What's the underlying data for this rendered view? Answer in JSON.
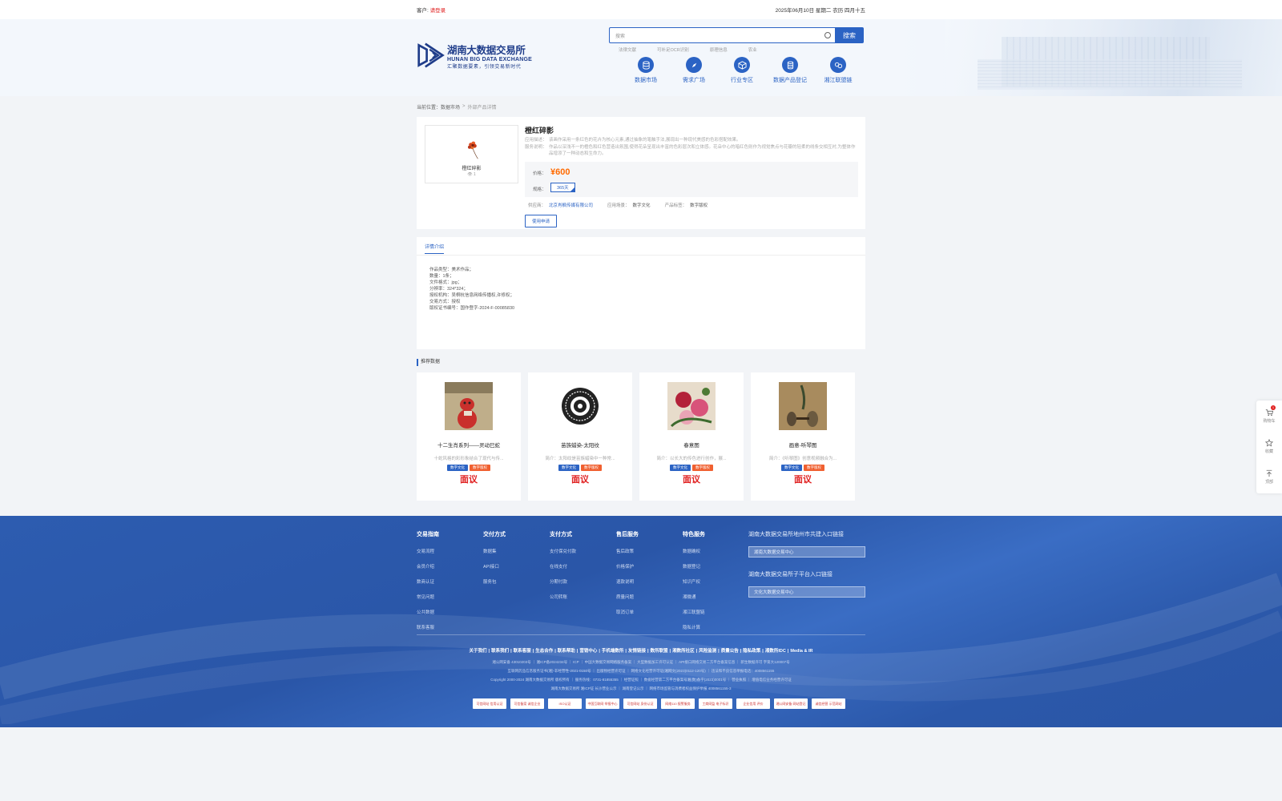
{
  "topbar": {
    "greeting": "客户:",
    "login": "请登录",
    "date": "2025年06月10日 星期二 农历 四月十五"
  },
  "logo": {
    "cn": "湖南大数据交易所",
    "en": "HUNAN BIG DATA EXCHANGE",
    "slogan": "汇聚数据要素，引领交易新时代"
  },
  "search": {
    "placeholder": "搜索",
    "button": "搜索",
    "hotwords": [
      "法律文献",
      "可补足OCR识别",
      "原理信息",
      "农业"
    ]
  },
  "nav": [
    {
      "label": "数据市场",
      "icon": "database-icon"
    },
    {
      "label": "需求广场",
      "icon": "compass-icon"
    },
    {
      "label": "行业专区",
      "icon": "cube-icon"
    },
    {
      "label": "数据产品登记",
      "icon": "register-icon"
    },
    {
      "label": "湘江联盟链",
      "icon": "chain-icon"
    }
  ],
  "breadcrumb": {
    "prefix": "当前位置：",
    "level1": "数据市场",
    "sep": ">",
    "current": "外部产品详情"
  },
  "product": {
    "title": "橙红碎影",
    "image_name": "橙红碎影",
    "views": "👁 1",
    "desc_label": "应用描述：",
    "desc": "该画作采用一条红色的花卉为核心元素,通过抽象的笔触手法,展现出一种现代美感的色彩搭配效果。",
    "service_label": "服务说明：",
    "service": "作品以深浅不一的橙色和红色营造出氛围,使得花朵呈现出丰富的色彩层次和立体感。花朵中心的暗红色则作为视觉焦点与花瓣的轻柔的线条交相互衬,为整体作品增添了一种动态和生命力。",
    "price_label": "价格：",
    "price": "¥600",
    "spec_label": "规格：",
    "spec": "365天",
    "supplier_label": "供应商：",
    "supplier": "北京肖枫传媒有限公司",
    "scene_label": "应用场景：",
    "scene": "数字文化",
    "tag_label": "产品标签：",
    "tag": "数字版权",
    "apply_button": "使用申请"
  },
  "detail": {
    "tab": "详情介绍",
    "lines": [
      "作品类型：美术作品；",
      "数量：1条；",
      "文件格式：jpg；",
      "分辨率：324*324；",
      "授权机构：吴桐杭信息网络传播权,许修权；",
      "交易方式：授权",
      "版权证书编号：国作登字-2024-F-00085830"
    ]
  },
  "recommend": {
    "title": "推荐数据",
    "items": [
      {
        "name": "十二生肖系列——灵动巳蛇",
        "desc": "十蛇风格的彩形象结合了现代与传...",
        "tag1": "数字文化",
        "tag2": "数字版权",
        "price": "面议"
      },
      {
        "name": "苗族蜡染-太阳纹",
        "desc": "简介：太阳纹是苗族蜡染中一种常...",
        "tag1": "数字文化",
        "tag2": "数字版权",
        "price": "面议"
      },
      {
        "name": "春意图",
        "desc": "简介：以长大的传色进行创作，展...",
        "tag1": "数字文化",
        "tag2": "数字版权",
        "price": "面议"
      },
      {
        "name": "画意-听琴图",
        "desc": "简介：《听琴图》创意视频融合为...",
        "tag1": "数字文化",
        "tag2": "数字版权",
        "price": "面议"
      }
    ]
  },
  "side": {
    "cart": "购物车",
    "cart_count": "1",
    "fav": "收藏",
    "top": "顶部"
  },
  "footer": {
    "cols": [
      {
        "title": "交易指南",
        "items": [
          "交易流程",
          "会员介绍",
          "数商认证",
          "常见问题",
          "公共数据",
          "联系客服"
        ]
      },
      {
        "title": "交付方式",
        "items": [
          "数据集",
          "API接口",
          "服务包"
        ]
      },
      {
        "title": "支付方式",
        "items": [
          "支付保兑付款",
          "在线支付",
          "分期付款",
          "公司转账"
        ]
      },
      {
        "title": "售后服务",
        "items": [
          "售后政策",
          "价格保护",
          "退款说明",
          "质量问题",
          "取消订单"
        ]
      },
      {
        "title": "特色服务",
        "items": [
          "数据确权",
          "数据登记",
          "知识产权",
          "湘微通",
          "湘江联盟链",
          "隐私计算"
        ]
      }
    ],
    "right_title1": "湖南大数据交易所地州市共建入口链接",
    "right_select1": "湖南大数据交易中心",
    "right_title2": "湖南大数据交易所子平台入口链接",
    "right_select2": "文化大数据交易中心",
    "links": [
      "关于我们",
      "联系我们",
      "联系客服",
      "生态合作",
      "联系帮助",
      "营销中心",
      "手机端数所",
      "友情链接",
      "数所联盟",
      "湘数所社区",
      "风险监测",
      "质量公告",
      "隐私政策",
      "湘数所IDC",
      "Media & IR"
    ],
    "copy_lines": [
      "湘公网安备 43010203号 ｜ 湘ICP备2024234号 ｜ ICP ｜ 中国大数据交易网络服务备案 ｜ 大型数据加工许可认证 ｜ API接口网络交易二方平台备案信息 ｜ 新生数据许可 字第大120007号",
      "互联网药品信息服务证书(湘)-非经营性-2021-0150号 ｜ 出版物经营许可证 ｜ 网络文化经营许可证(湘网文(2023)0112-120号) ｜ 违法和不良信息举报电话：4008561155",
      "Copyright 2000-2024 湖南大数据交易所 版权所有 ｜ 服务热线：0731-81855355 ｜ 经营证照 ｜ 数据经营第二方平台备案号湘(数)备字(2023)0001号 ｜ 营业执照 ｜ 增值电信业务经营许可证",
      "湖南大数据交易所 湘ICP证 长沙营业公示 ｜ 湖南登记公示 ｜ 网络市场监管与消费者权益保护举报 4008561155-3"
    ],
    "badges": [
      "可信网站 信用认证",
      "可信备案 诚信企业",
      "ISO认证",
      "中国互联网 举报中心",
      "可信网站 身份认证",
      "网络110 报警服务",
      "工商网监 电子标识",
      "企业信用 评价",
      "湘公网安备 网站登记",
      "诚信经营 示范网站"
    ]
  }
}
